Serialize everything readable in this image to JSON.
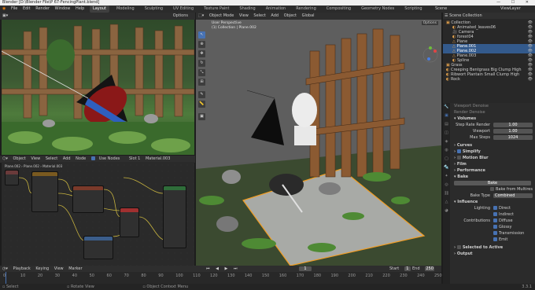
{
  "titlebar": {
    "title": "Blender [D:\\Blender File\\P 67-FencingPlant.blend]"
  },
  "menubar": {
    "items": [
      "File",
      "Edit",
      "Render",
      "Window",
      "Help"
    ],
    "tabs": [
      "Layout",
      "Modeling",
      "Sculpting",
      "UV Editing",
      "Texture Paint",
      "Shading",
      "Animation",
      "Rendering",
      "Compositing",
      "Geometry Nodes",
      "Scripting"
    ],
    "scene": "Scene",
    "view_layer": "ViewLayer"
  },
  "image_editor": {
    "options": "Options"
  },
  "node_editor": {
    "header": [
      "Object",
      "View",
      "Select",
      "Add",
      "Node"
    ],
    "use_nodes": "Use Nodes",
    "slot": "Slot 1",
    "material": "Material.003",
    "breadcrumb": [
      "Plane.002",
      "Plane.002",
      "Material.003"
    ]
  },
  "viewport": {
    "mode": "Object Mode",
    "menus": [
      "View",
      "Select",
      "Add",
      "Object"
    ],
    "transform": "Global",
    "view_label": "User Perspective",
    "collection_label": "(1) Collection | Plane.002",
    "options": "Options"
  },
  "outliner": {
    "header": "Scene Collection",
    "items": [
      {
        "label": "Collection",
        "selected": false
      },
      {
        "label": "Animated_leaves06",
        "selected": false
      },
      {
        "label": "Camera",
        "selected": false
      },
      {
        "label": "forest04",
        "selected": false
      },
      {
        "label": "Plane",
        "selected": false
      },
      {
        "label": "Plane.001",
        "selected": true
      },
      {
        "label": "Plane.002",
        "selected": true
      },
      {
        "label": "Plane.003",
        "selected": false
      },
      {
        "label": "Spline",
        "selected": false
      },
      {
        "label": "Grass",
        "selected": false
      },
      {
        "label": "Creeping Bentgrass Big Clump High",
        "selected": false
      },
      {
        "label": "Ribwort Plantain Small Clump High",
        "selected": false
      },
      {
        "label": "Rock",
        "selected": false
      }
    ]
  },
  "properties": {
    "viewport_denoise": "Viewport Denoise",
    "render_denoise": "Render Denoise",
    "sections": {
      "volumes": "Volumes",
      "curves": "Curves",
      "simplify": "Simplify",
      "motion_blur": "Motion Blur",
      "film": "Film",
      "performance": "Performance",
      "bake": "Bake",
      "influence": "Influence",
      "selected_to_active": "Selected to Active",
      "output": "Output"
    },
    "volumes": {
      "step_rate_render_label": "Step Rate Render",
      "step_rate_render": "1.00",
      "viewport_label": "Viewport",
      "viewport": "1.00",
      "max_steps_label": "Max Steps",
      "max_steps": "1024"
    },
    "bake": {
      "button": "Bake",
      "from_multires": "Bake from Multires",
      "bake_type_label": "Bake Type",
      "bake_type": "Combined"
    },
    "influence": {
      "lighting_label": "Lighting",
      "direct": "Direct",
      "indirect": "Indirect",
      "contributions_label": "Contributions",
      "diffuse": "Diffuse",
      "glossy": "Glossy",
      "transmission": "Transmission",
      "emit": "Emit"
    }
  },
  "timeline": {
    "menus": [
      "Playback",
      "Keying",
      "View",
      "Marker"
    ],
    "start_label": "Start",
    "start": "1",
    "end_label": "End",
    "end": "250",
    "current": "1",
    "ticks": [
      "0",
      "10",
      "20",
      "30",
      "40",
      "50",
      "60",
      "70",
      "80",
      "90",
      "100",
      "110",
      "120",
      "130",
      "140",
      "150",
      "160",
      "170",
      "180",
      "190",
      "200",
      "210",
      "220",
      "230",
      "240",
      "250"
    ]
  },
  "statusbar": {
    "select": "Select",
    "rotate": "Rotate View",
    "context": "Object Context Menu",
    "version": "3.3.1"
  },
  "colors": {
    "accent": "#4772b3",
    "selection": "#f29d23",
    "wire": "#c7b33f"
  }
}
